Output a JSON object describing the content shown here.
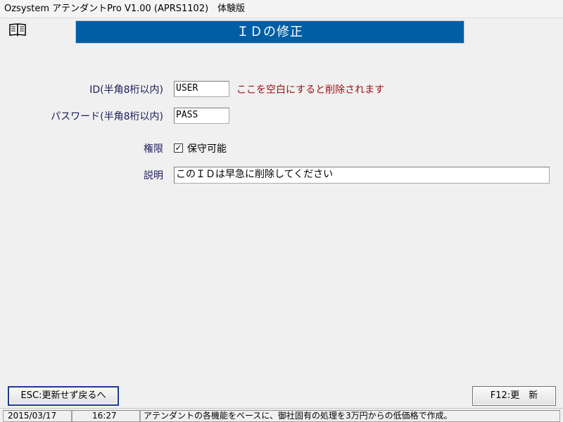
{
  "window": {
    "title": "Ozsystem アテンダントPro V1.00 (APRS1102)　体験版"
  },
  "header": {
    "title": "ＩＤの修正",
    "book_icon": "book-icon"
  },
  "form": {
    "id": {
      "label": "ID(半角8桁以内)",
      "value": "USER",
      "note": "ここを空白にすると削除されます"
    },
    "password": {
      "label": "パスワード(半角8桁以内)",
      "value": "PASS"
    },
    "permission": {
      "label": "権限",
      "checked": true,
      "check_mark": "✓",
      "option_label": "保守可能"
    },
    "description": {
      "label": "説明",
      "value": "このＩＤは早急に削除してください"
    }
  },
  "buttons": {
    "esc_label": "ESC:更新せず戻るへ",
    "f12_label": "F12:更　新"
  },
  "status": {
    "date": "2015/03/17",
    "time": "16:27",
    "message": "アテンダントの各機能をベースに、御社固有の処理を3万円からの低価格で作成。"
  },
  "colors": {
    "header_bg": "#005ea5",
    "warning_text": "#a01010",
    "label_text": "#1c1c5a"
  }
}
